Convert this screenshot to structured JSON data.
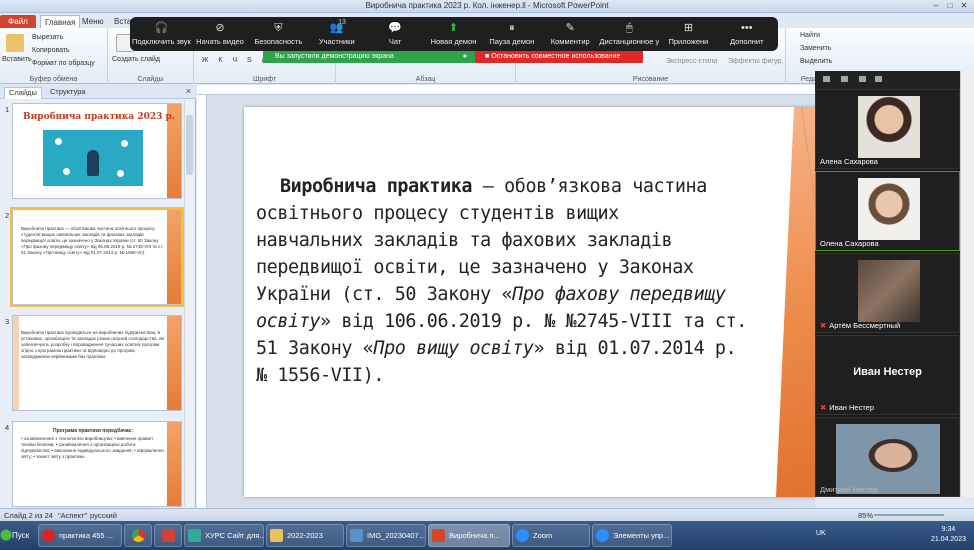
{
  "window": {
    "title": "Виробнича практика 2023 р. Кол. інженер.ll - Microsoft PowerPoint"
  },
  "ribbon": {
    "tabs": [
      "Файл",
      "Главная",
      "Меню",
      "Встав"
    ],
    "active_tab": "Главная",
    "clipboard": {
      "paste": "Вставить",
      "cut": "Вырезать",
      "copy": "Копировать",
      "format": "Формат по образцу",
      "label": "Буфер обмена"
    },
    "slides": {
      "new_slide": "Создать слайд",
      "label": "Слайды"
    },
    "font": {
      "label": "Шрифт"
    },
    "paragraph": {
      "label": "Абзац"
    },
    "drawing": {
      "label": "Рисование",
      "effects": "Эффекты фигур",
      "express": "Экспресс-стили"
    },
    "editing": {
      "find": "Найти",
      "replace": "Заменить",
      "select": "Выделить",
      "label": "Редактир"
    }
  },
  "zoom": {
    "toolbar": [
      {
        "label": "Подключить звук",
        "icon": "headphones-icon"
      },
      {
        "label": "Начать видео",
        "icon": "video-off-icon"
      },
      {
        "label": "Безопасность",
        "icon": "shield-icon"
      },
      {
        "label": "Участники",
        "icon": "participants-icon",
        "badge": "13"
      },
      {
        "label": "Чат",
        "icon": "chat-icon"
      },
      {
        "label": "Новая демон",
        "icon": "share-screen-icon"
      },
      {
        "label": "Пауза демон",
        "icon": "pause-icon"
      },
      {
        "label": "Комментир",
        "icon": "pencil-icon"
      },
      {
        "label": "Дистанционное у",
        "icon": "mouse-icon"
      },
      {
        "label": "Приложени",
        "icon": "apps-icon"
      },
      {
        "label": "Дополнит",
        "icon": "more-icon"
      }
    ],
    "share_notice": "Вы запустили демонстрацию экрана",
    "stop_share": "Остановить совместное использование",
    "participants": [
      {
        "name": "Алена Сахарова",
        "muted": false
      },
      {
        "name": "Олена Сахарова",
        "muted": false
      },
      {
        "name": "Артём Бессмертный",
        "muted": true
      },
      {
        "name": "Иван Нестер",
        "muted": true,
        "display": "Иван Нестер"
      },
      {
        "name": "Дмитрий Нестер",
        "muted": false
      }
    ]
  },
  "pane": {
    "tabs": [
      "Слайды",
      "Структура"
    ],
    "close": "×",
    "slides": [
      {
        "num": "1",
        "title": "Виробнича практика 2023 р."
      },
      {
        "num": "2",
        "text": "Виробнича практика — обов'язкова частина освітнього процесу студентів вищих навчальних закладів та фахових закладів передвищої освіти, це зазначено у Законах України (ст. 50 Закону «Про фахову передвищу освіту» від 06.06.2019 р. № 2745-VIII та ст. 51 Закону «Про вищу освіту» від 01.07.2014 р. № 1556-VII)."
      },
      {
        "num": "3",
        "text": "Виробнича практика проводиться на виробничих підприємствах, в установах, організаціях та закладах різних галузей господарства, які забезпечують розробку і впровадження сучасних освітніх програм згідно з програмою практики та відповідно до програм, затверджених керівниками баз практики."
      },
      {
        "num": "4",
        "title": "Програма практики передбачає:",
        "text": "• ознайомлення з технологією виробництва; • вивчення правил техніки безпеки; • ознайомлення з організацією роботи підприємства; • виконання індивідуального завдання; • оформлення звіту; • захист звіту з практики."
      }
    ]
  },
  "slide": {
    "bold_part": "Виробнича практика",
    "line1": " — обов’язкова частина",
    "line2": "освітнього процесу студентів вищих",
    "line3": "навчальних закладів та фахових закладів",
    "line4": "передвищої освіти, це зазначено у Законах",
    "line5a": "України (ст. 50  Закону «",
    "line5b": "Про фахову передвищу",
    "line6a": "освіту",
    "line6b": "» від 106.06.2019 р. № №2745-VIII та ст.",
    "line7a": "51  Закону «",
    "line7b": "Про вищу освіту",
    "line7c": "» від 01.07.2014 р.",
    "line8": "№ 1556-VII)."
  },
  "status": {
    "slide": "Слайд 2 из 24",
    "theme": "\"Аспект\"",
    "lang": "русский",
    "zoom": "85%"
  },
  "taskbar": {
    "start": "Пуск",
    "items": [
      "практика 455 ...",
      "",
      "",
      "ХУРС Сайт для...",
      "2022-2023",
      "IMG_20230407...",
      "Виробнича п...",
      "Zoom",
      "Элементы упр..."
    ],
    "lang": "UK",
    "time": "9:34",
    "date": "21.04.2023"
  }
}
